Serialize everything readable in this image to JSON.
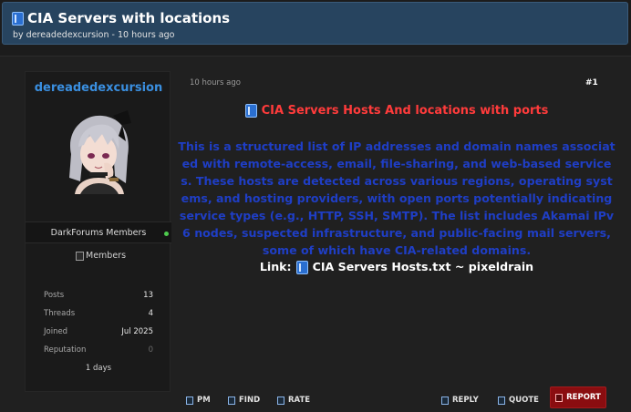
{
  "thread": {
    "title": "CIA Servers with locations",
    "meta": "by dereadedexcursion - 10 hours ago"
  },
  "user": {
    "username": "dereadedexcursion",
    "group": "DarkForums Members",
    "group_image_alt": "Members",
    "stats": [
      {
        "label": "Posts",
        "value": "13"
      },
      {
        "label": "Threads",
        "value": "4"
      },
      {
        "label": "Joined",
        "value": "Jul 2025"
      },
      {
        "label": "Reputation",
        "value": "0"
      }
    ],
    "days": "1 days",
    "online_color": "#4ecb4e"
  },
  "post": {
    "date": "10 hours ago",
    "number": "#1",
    "heading": "CIA Servers Hosts And locations with ports",
    "body": "This is a structured list of IP addresses and domain names associated with remote-access, email, file-sharing, and web-based services. These hosts are detected across various regions, operating systems, and hosting providers, with open ports potentially indicating service types (e.g., HTTP, SSH, SMTP). The list includes Akamai IPv6 nodes, suspected infrastructure, and public-facing mail servers, some of which have CIA-related domains.",
    "link_label": "Link:",
    "link_text": "CIA Servers Hosts.txt ~ pixeldrain",
    "heading_color": "#ff3b3b",
    "body_color": "#1f3ec5"
  },
  "actions": {
    "pm": "PM",
    "find": "FIND",
    "rate": "RATE",
    "reply": "REPLY",
    "quote": "QUOTE",
    "report": "REPORT"
  },
  "icons": {
    "title": "book-icon",
    "heading": "book-icon",
    "link": "book-icon"
  }
}
